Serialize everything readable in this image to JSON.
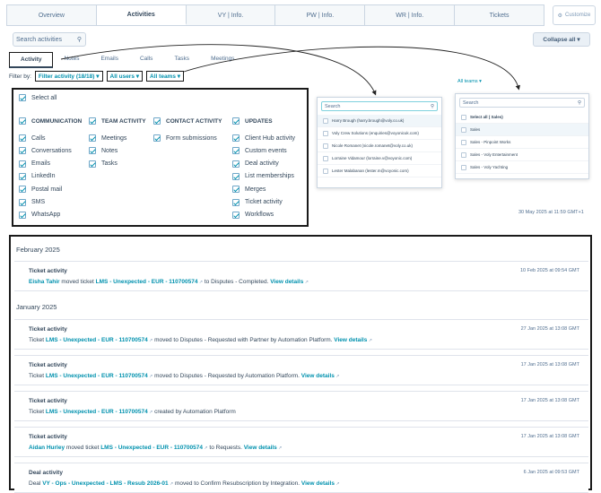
{
  "top_tabs": [
    "Overview",
    "Activities",
    "VY | Info.",
    "PW | Info.",
    "WR | Info.",
    "Tickets"
  ],
  "customize": "Customize",
  "search": {
    "placeholder": "Search activities"
  },
  "collapse": "Collapse all",
  "sub_tabs": [
    "Activity",
    "Notes",
    "Emails",
    "Calls",
    "Tasks",
    "Meetings"
  ],
  "filter": {
    "label": "Filter by:",
    "activity": "Filter activity (18/18)",
    "users": "All users",
    "teams": "All teams"
  },
  "panel": {
    "select_all": "Select all",
    "headers": [
      "COMMUNICATION",
      "TEAM ACTIVITY",
      "CONTACT ACTIVITY",
      "UPDATES"
    ],
    "communication": [
      "Calls",
      "Conversations",
      "Emails",
      "LinkedIn",
      "Postal mail",
      "SMS",
      "WhatsApp"
    ],
    "team": [
      "Meetings",
      "Notes",
      "Tasks"
    ],
    "contact": [
      "Form submissions"
    ],
    "updates": [
      "Client Hub activity",
      "Custom events",
      "Deal activity",
      "List memberships",
      "Merges",
      "Ticket activity",
      "Workflows"
    ]
  },
  "users_dd": {
    "search": "Search",
    "items": [
      "Harry Brough (harry.brough@voly.co.uk)",
      "Voly Crew Solutions (enquiries@voyonicuk.com)",
      "Nicole Romanet (nicole.romanet@voly.co.uk)",
      "Lorraine Vidamour (lorraine.v@voyonic.com)",
      "Lester Malabanan (lester.m@voyonic.com)"
    ]
  },
  "teams_dd": {
    "label": "All teams",
    "search": "Search",
    "items": [
      "Select all ( Sales)",
      "Sales",
      "Sales - Pinpoint Works",
      "Sales - Voly Entertainment",
      "Sales - Voly Yachting"
    ]
  },
  "stray_date": "30 May 2025 at 11:59 GMT+1",
  "feed": {
    "months": [
      "February 2025",
      "January 2025"
    ],
    "cards": [
      {
        "title": "Ticket activity",
        "pre": "Eisha Tahir",
        "mid": " moved ticket ",
        "ticket": "LMS - Unexpected - EUR - 110700574",
        "post": " to Disputes - Completed. ",
        "link": "View details",
        "date": "10 Feb 2025 at 09:54 GMT"
      },
      {
        "title": "Ticket activity",
        "pre": "",
        "mid": "Ticket ",
        "ticket": "LMS - Unexpected - EUR - 110700574",
        "post": " moved to Disputes - Requested with Partner by Automation Platform. ",
        "link": "View details",
        "date": "27 Jan 2025 at 13:08 GMT"
      },
      {
        "title": "Ticket activity",
        "pre": "",
        "mid": "Ticket ",
        "ticket": "LMS - Unexpected - EUR - 110700574",
        "post": " moved to Disputes - Requested by Automation Platform. ",
        "link": "View details",
        "date": "17 Jan 2025 at 13:08 GMT"
      },
      {
        "title": "Ticket activity",
        "pre": "",
        "mid": "Ticket ",
        "ticket": "LMS - Unexpected - EUR - 110700574",
        "post": " created by Automation Platform",
        "link": "",
        "date": "17 Jan 2025 at 13:08 GMT"
      },
      {
        "title": "Ticket activity",
        "pre": "Aidan Hurley",
        "mid": " moved ticket ",
        "ticket": "LMS - Unexpected - EUR - 110700574",
        "post": " to Requests. ",
        "link": "View details",
        "date": "17 Jan 2025 at 13:08 GMT"
      },
      {
        "title": "Deal activity",
        "pre": "",
        "mid": "Deal ",
        "ticket": "VY - Ops - Unexpected - LMS - Resub 2026-01",
        "post": " moved to Confirm Resubscription by Integration. ",
        "link": "View details",
        "date": "6 Jan 2025 at 09:53 GMT"
      }
    ]
  }
}
